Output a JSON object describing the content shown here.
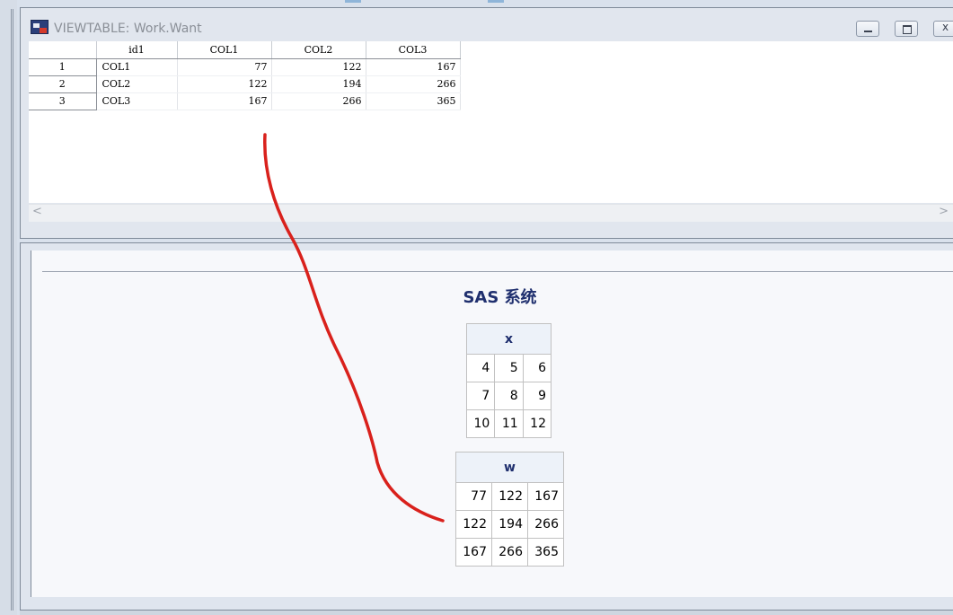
{
  "viewtable": {
    "title": "VIEWTABLE: Work.Want",
    "columns": [
      "id1",
      "COL1",
      "COL2",
      "COL3"
    ],
    "rows": [
      {
        "n": "1",
        "id1": "COL1",
        "c1": "77",
        "c2": "122",
        "c3": "167"
      },
      {
        "n": "2",
        "id1": "COL2",
        "c1": "122",
        "c2": "194",
        "c3": "266"
      },
      {
        "n": "3",
        "id1": "COL3",
        "c1": "167",
        "c2": "266",
        "c3": "365"
      }
    ],
    "scroll_left": "<",
    "scroll_right": ">"
  },
  "results": {
    "title": "SAS 系统",
    "matrix_x": {
      "header": "x",
      "rows": [
        [
          "4",
          "5",
          "6"
        ],
        [
          "7",
          "8",
          "9"
        ],
        [
          "10",
          "11",
          "12"
        ]
      ]
    },
    "matrix_w": {
      "header": "w",
      "rows": [
        [
          "77",
          "122",
          "167"
        ],
        [
          "122",
          "194",
          "266"
        ],
        [
          "167",
          "266",
          "365"
        ]
      ]
    }
  },
  "colors": {
    "annotation": "#d9211c",
    "results_title": "#1f2f6e"
  }
}
